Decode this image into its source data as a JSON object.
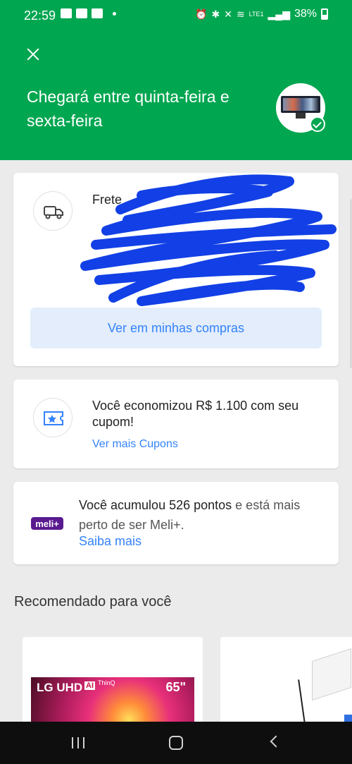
{
  "status_bar": {
    "time": "22:59",
    "network": "LTE1",
    "battery": "38%"
  },
  "header": {
    "close_label": "",
    "title": "Chegará entre quinta-feira e sexta-feira",
    "accent_color": "#00a650"
  },
  "shipping_card": {
    "title": "Frete",
    "description": "",
    "button_label": "Ver em minhas compras"
  },
  "coupon_card": {
    "message": "Você economizou R$ 1.100 com seu cupom!",
    "link_label": "Ver mais Cupons"
  },
  "points_card": {
    "badge": "meli+",
    "message_strong": "Você acumulou 526 pontos",
    "message_rest": " e está mais perto de ser Meli+.",
    "link_label": "Saiba mais"
  },
  "recommendations": {
    "title": "Recomendado para você",
    "items": [
      {
        "brand": "LG UHD",
        "badge": "AI",
        "sub": "ThinQ",
        "size": "65\""
      },
      {
        "brand": ""
      }
    ]
  },
  "colors": {
    "link": "#3483fa",
    "card_bg": "#ffffff",
    "page_bg": "#ebebeb",
    "meli_purple": "#5a1a8f"
  }
}
